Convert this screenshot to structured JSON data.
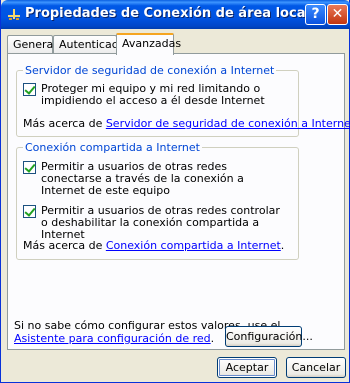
{
  "window": {
    "title": "Propiedades de Conexión de área local",
    "help_label": "?",
    "close_label": "✕"
  },
  "tabs": [
    {
      "label": "General",
      "active": false
    },
    {
      "label": "Autenticación",
      "active": false
    },
    {
      "label": "Avanzadas",
      "active": true
    }
  ],
  "firewall": {
    "title": "Servidor de seguridad de conexión a Internet",
    "checkbox_label": "Proteger mi equipo y mi red limitando o impidiendo el acceso a él desde Internet",
    "checked": true,
    "more_prefix": "Más acerca de ",
    "more_link": "Servidor de seguridad de conexión a Internet",
    "more_suffix": "."
  },
  "ics": {
    "title": "Conexión compartida a Internet",
    "checkbox1_label": "Permitir a usuarios de otras redes conectarse a  través de la conexión a Internet de este equipo",
    "checkbox1_checked": true,
    "checkbox2_label": "Permitir a usuarios de otras redes controlar o deshabilitar la conexión compartida a Internet",
    "checkbox2_checked": true,
    "more_prefix": "Más acerca de ",
    "more_link": "Conexión compartida a Internet",
    "more_suffix": "."
  },
  "footer": {
    "hint_text": "Si no sabe cómo configurar estos valores, use el",
    "wizard_link": "Asistente para configuración de red",
    "hint_suffix": ".",
    "settings_button": "Configuración..."
  },
  "buttons": {
    "accept": "Aceptar",
    "cancel": "Cancelar"
  },
  "colors": {
    "titlebar": "#0054e3",
    "group_title": "#0046d5",
    "link": "#0000ff",
    "tab_highlight": "#f5a521",
    "check": "#21a121"
  }
}
